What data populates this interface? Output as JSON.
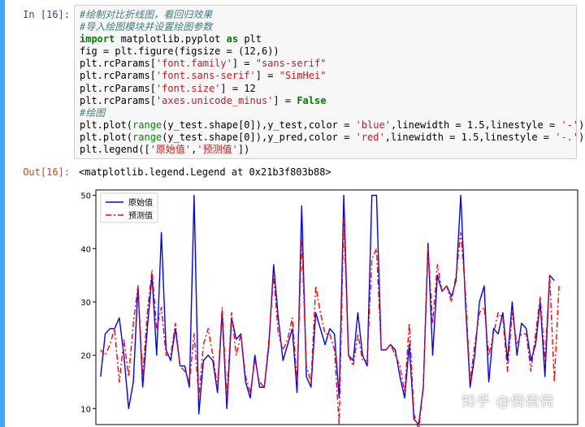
{
  "cell_in": {
    "prompt": "In  [16]:",
    "code_lines": [
      "#绘制对比折线图，看回归效果",
      "#导入绘图模块并设置绘图参数",
      "import matplotlib.pyplot as plt",
      "fig = plt.figure(figsize = (12,6))",
      "plt.rcParams['font.family'] = \"sans-serif\"",
      "plt.rcParams['font.sans-serif'] = \"SimHei\"",
      "plt.rcParams['font.size'] = 12",
      "plt.rcParams['axes.unicode_minus'] = False",
      "#绘图",
      "plt.plot(range(y_test.shape[0]),y_test,color = 'blue',linewidth = 1.5,linestyle = '-')",
      "plt.plot(range(y_test.shape[0]),y_pred,color = 'red',linewidth = 1.5,linestyle = '-.')",
      "plt.legend(['原始值','预测值'])"
    ]
  },
  "cell_out": {
    "prompt": "Out[16]:",
    "text": "<matplotlib.legend.Legend at 0x21b3f803b88>"
  },
  "watermark": "知乎 @倪倪倪",
  "chart_data": {
    "type": "line",
    "ylim": [
      7,
      51
    ],
    "xlim": [
      -1,
      102
    ],
    "yticks": [
      10,
      20,
      30,
      40,
      50
    ],
    "grid": false,
    "legend_position": "top-left",
    "series": [
      {
        "name": "原始值",
        "color": "#0000ff",
        "linestyle": "solid",
        "values": [
          16,
          24,
          25,
          25,
          27,
          20,
          10,
          15,
          33,
          14,
          25,
          35,
          20,
          43,
          21,
          19,
          25,
          18,
          18,
          14,
          50,
          9,
          19,
          20,
          19,
          13,
          28,
          10,
          27,
          23,
          24,
          15,
          12,
          20,
          14,
          14,
          22,
          37,
          27,
          19,
          22,
          25,
          13,
          48,
          16,
          14,
          28,
          25,
          22,
          25,
          24,
          12,
          50,
          20,
          19,
          28,
          20,
          18,
          50,
          50,
          21,
          21,
          22,
          21,
          16,
          12,
          22,
          8,
          7,
          14,
          41,
          20,
          35,
          32,
          33,
          31,
          34,
          50,
          30,
          14,
          20,
          30,
          33,
          15,
          25,
          24,
          28,
          19,
          30,
          20,
          26,
          25,
          19,
          22,
          30,
          16,
          35,
          34
        ]
      },
      {
        "name": "预测值",
        "color": "#ff0000",
        "linestyle": "dashdot",
        "values": [
          21,
          20,
          22,
          25,
          15,
          23,
          16,
          26,
          33,
          16,
          28,
          36,
          25,
          29,
          20,
          20,
          26,
          18,
          17,
          15,
          24,
          12,
          22,
          25,
          20,
          14,
          29,
          12,
          28,
          20,
          24,
          16,
          13,
          19,
          15,
          14,
          23,
          35,
          24,
          21,
          23,
          27,
          15,
          42,
          18,
          15,
          33,
          28,
          24,
          24,
          21,
          7,
          46,
          20,
          18,
          24,
          19,
          19,
          38,
          40,
          21,
          21,
          22,
          20,
          18,
          13,
          26,
          9,
          6,
          14,
          40,
          26,
          37,
          32,
          33,
          30,
          35,
          43,
          32,
          15,
          22,
          28,
          29,
          20,
          24,
          28,
          27,
          17,
          28,
          22,
          24,
          24,
          17,
          24,
          31,
          19,
          35,
          15,
          33
        ]
      }
    ]
  }
}
